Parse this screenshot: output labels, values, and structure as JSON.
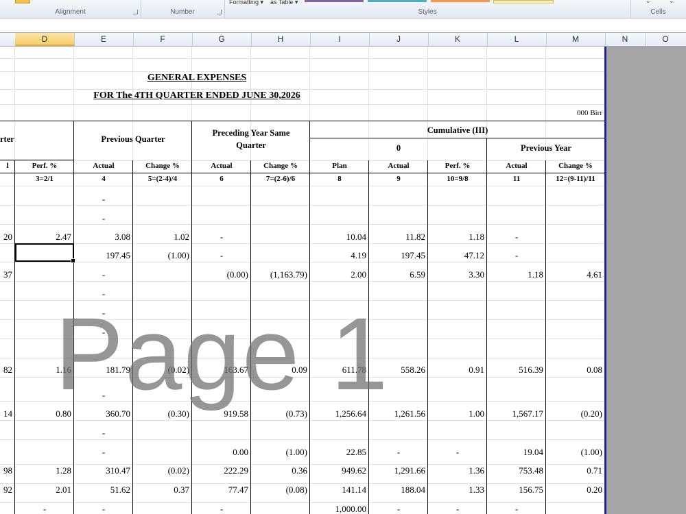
{
  "ribbon": {
    "groups": [
      "Alignment",
      "Number",
      "Styles",
      "Cells"
    ],
    "formatting_label": "Formatting",
    "as_table_label": "as Table"
  },
  "columns": [
    "D",
    "E",
    "F",
    "G",
    "H",
    "I",
    "J",
    "K",
    "L",
    "M",
    "N",
    "O"
  ],
  "selected_column": "D",
  "sheet": {
    "title": "GENERAL EXPENSES",
    "subtitle": "FOR The 4TH QUARTER ENDED JUNE 30,2026",
    "unit": "000 Birr",
    "headers": {
      "current_quarter_partial": "rter",
      "previous_quarter": "Previous Quarter",
      "preceding_year_line1": "Preceding Year Same",
      "preceding_year_line2": "Quarter",
      "cumulative": "Cumulative (III)",
      "cumulative_current": "0",
      "cumulative_previous": "Previous Year"
    },
    "subheaders": [
      "l",
      "Perf. %",
      "Actual",
      "Change %",
      "Actual",
      "Change %",
      "Plan",
      "Actual",
      "Perf. %",
      "Actual",
      "Change %"
    ],
    "formulas": [
      "",
      "3=2/1",
      "4",
      "5=(2-4)/4",
      "6",
      "7=(2-6)/6",
      "8",
      "9",
      "10=9/8",
      "11",
      "12=(9-11)/11"
    ],
    "rows": [
      [
        "",
        "",
        "-",
        "",
        "",
        "",
        "",
        "",
        "",
        "",
        ""
      ],
      [
        "",
        "",
        "-",
        "",
        "",
        "",
        "",
        "",
        "",
        "",
        ""
      ],
      [
        "20",
        "2.47",
        "3.08",
        "1.02",
        "-",
        "",
        "10.04",
        "11.82",
        "1.18",
        "-",
        ""
      ],
      [
        "",
        "",
        "197.45",
        "(1.00)",
        "-",
        "",
        "4.19",
        "197.45",
        "47.12",
        "-",
        ""
      ],
      [
        "37",
        "",
        "-",
        "",
        "(0.00)",
        "(1,163.79)",
        "2.00",
        "6.59",
        "3.30",
        "1.18",
        "4.61"
      ],
      [
        "",
        "",
        "-",
        "",
        "",
        "",
        "",
        "",
        "",
        "",
        ""
      ],
      [
        "",
        "",
        "-",
        "",
        "",
        "",
        "",
        "",
        "",
        "",
        ""
      ],
      [
        "",
        "",
        "-",
        "",
        "",
        "",
        "",
        "",
        "",
        "",
        ""
      ],
      [
        "82",
        "1.16",
        "181.79",
        "(0.02)",
        "163.67",
        "0.09",
        "611.78",
        "558.26",
        "0.91",
        "516.39",
        "0.08"
      ],
      [
        "",
        "",
        "-",
        "",
        "",
        "",
        "",
        "",
        "",
        "",
        ""
      ],
      [
        "14",
        "0.80",
        "360.70",
        "(0.30)",
        "919.58",
        "(0.73)",
        "1,256.64",
        "1,261.56",
        "1.00",
        "1,567.17",
        "(0.20)"
      ],
      [
        "",
        "",
        "-",
        "",
        "",
        "",
        "",
        "",
        "",
        "",
        ""
      ],
      [
        "",
        "",
        "-",
        "",
        "0.00",
        "(1.00)",
        "22.85",
        "-",
        "-",
        "19.04",
        "(1.00)"
      ],
      [
        "98",
        "1.28",
        "310.47",
        "(0.02)",
        "222.29",
        "0.36",
        "949.62",
        "1,291.66",
        "1.36",
        "753.48",
        "0.71"
      ],
      [
        "92",
        "2.01",
        "51.62",
        "0.37",
        "77.47",
        "(0.08)",
        "141.14",
        "188.04",
        "1.33",
        "156.75",
        "0.20"
      ],
      [
        "",
        "-",
        "-",
        "",
        "-",
        "",
        "1,000.00",
        "-",
        "-",
        "-",
        ""
      ]
    ]
  },
  "watermark": "Page 1"
}
